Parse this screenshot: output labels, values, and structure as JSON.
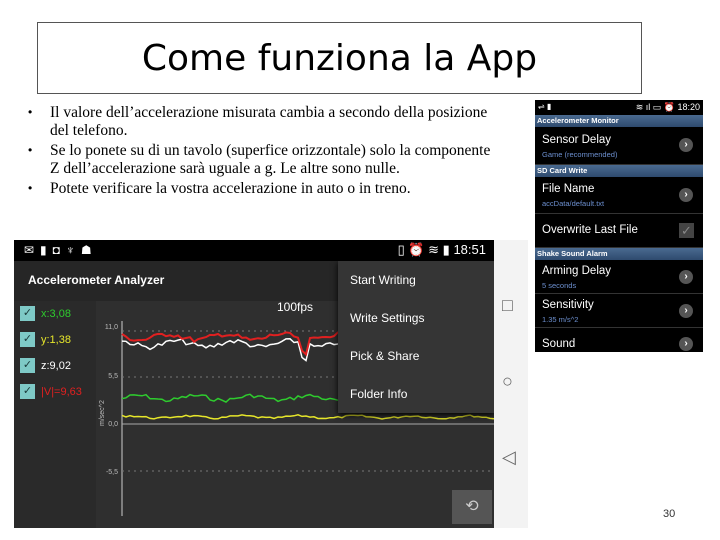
{
  "slide": {
    "title": "Come funziona la App",
    "page_number": "30",
    "bullets": [
      "Il valore dell’accelerazione misurata cambia a secondo della posizione del telefono.",
      "Se lo ponete su di un tavolo (superfice orizzontale) solo la componente Z dell’accelerazione sarà uguale a g. Le altre sono nulle.",
      "Potete verificare la vostra accelerazione in auto o in treno."
    ]
  },
  "analyzer": {
    "status_time": "18:51",
    "app_title": "Accelerometer Analyzer",
    "fps": "100fps",
    "axis_label": "m/sec^2",
    "y_ticks": [
      "11,0",
      "5,5",
      "0,0",
      "-5,5"
    ],
    "channels": [
      {
        "label": "x:3,08",
        "color": "#2ecc2e",
        "checked": true
      },
      {
        "label": "y:1,38",
        "color": "#e6e62a",
        "checked": true
      },
      {
        "label": "z:9,02",
        "color": "#ffffff",
        "checked": true
      },
      {
        "label": "|V|=9,63",
        "color": "#e02020",
        "checked": true
      }
    ],
    "menu": [
      "Start Writing",
      "Write Settings",
      "Pick & Share",
      "Folder Info"
    ]
  },
  "monitor": {
    "status_time": "18:20",
    "sections": [
      {
        "header": "Accelerometer Monitor",
        "items": [
          {
            "title": "Sensor Delay",
            "subtitle": "Game (recommended)",
            "control": "chevron"
          }
        ]
      },
      {
        "header": "SD Card Write",
        "items": [
          {
            "title": "File Name",
            "subtitle": "accData/default.txt",
            "control": "chevron"
          },
          {
            "title": "Overwrite Last File",
            "subtitle": "",
            "control": "checkbox",
            "checked": true
          }
        ]
      },
      {
        "header": "Shake Sound Alarm",
        "items": [
          {
            "title": "Arming Delay",
            "subtitle": "5 seconds",
            "control": "chevron"
          },
          {
            "title": "Sensitivity",
            "subtitle": "1.35 m/s^2",
            "control": "chevron"
          },
          {
            "title": "Sound",
            "subtitle": "",
            "control": "chevron"
          }
        ]
      }
    ]
  }
}
